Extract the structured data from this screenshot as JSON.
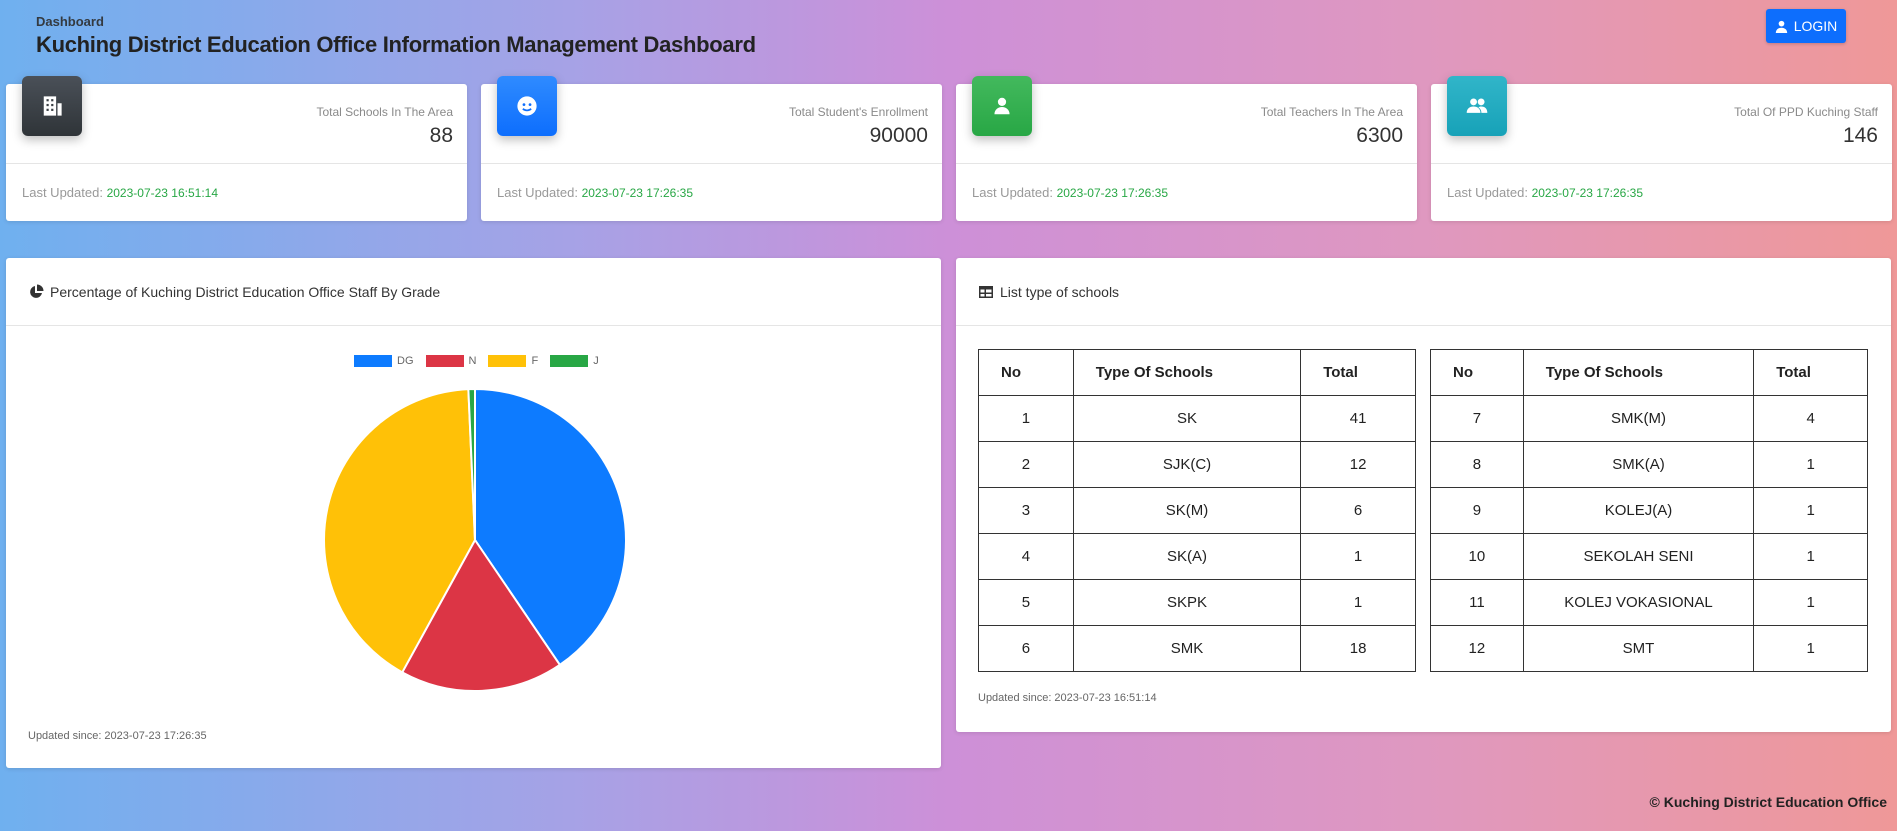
{
  "header": {
    "breadcrumb": "Dashboard",
    "title": "Kuching District Education Office Information Management Dashboard",
    "login_label": "LOGIN"
  },
  "stats": [
    {
      "label": "Total Schools In The Area",
      "value": "88",
      "updated_label": "Last Updated:",
      "updated": "2023-07-23 16:51:14",
      "color": "#343a40",
      "icon": "building-icon"
    },
    {
      "label": "Total Student's Enrollment",
      "value": "90000",
      "updated_label": "Last Updated:",
      "updated": "2023-07-23 17:26:35",
      "color": "#0d6efd",
      "icon": "student-icon"
    },
    {
      "label": "Total Teachers In The Area",
      "value": "6300",
      "updated_label": "Last Updated:",
      "updated": "2023-07-23 17:26:35",
      "color": "#28a745",
      "icon": "teacher-icon"
    },
    {
      "label": "Total Of PPD Kuching Staff",
      "value": "146",
      "updated_label": "Last Updated:",
      "updated": "2023-07-23 17:26:35",
      "color": "#17a2b8",
      "icon": "users-icon"
    }
  ],
  "chart_panel": {
    "title": "Percentage of Kuching District Education Office Staff By Grade",
    "footer": "Updated since: 2023-07-23 17:26:35"
  },
  "chart_data": {
    "type": "pie",
    "title": "",
    "labels": [
      "DG",
      "N",
      "F",
      "J"
    ],
    "values": [
      40.5,
      17.5,
      41.3,
      0.7
    ],
    "colors": [
      "#0d7bff",
      "#dc3545",
      "#ffc107",
      "#28a745"
    ]
  },
  "table_panel": {
    "title": "List type of schools",
    "footer": "Updated since: 2023-07-23 16:51:14",
    "headers": [
      "No",
      "Type Of Schools",
      "Total"
    ],
    "left_rows": [
      [
        "1",
        "SK",
        "41"
      ],
      [
        "2",
        "SJK(C)",
        "12"
      ],
      [
        "3",
        "SK(M)",
        "6"
      ],
      [
        "4",
        "SK(A)",
        "1"
      ],
      [
        "5",
        "SKPK",
        "1"
      ],
      [
        "6",
        "SMK",
        "18"
      ]
    ],
    "right_rows": [
      [
        "7",
        "SMK(M)",
        "4"
      ],
      [
        "8",
        "SMK(A)",
        "1"
      ],
      [
        "9",
        "KOLEJ(A)",
        "1"
      ],
      [
        "10",
        "SEKOLAH SENI",
        "1"
      ],
      [
        "11",
        "KOLEJ VOKASIONAL",
        "1"
      ],
      [
        "12",
        "SMT",
        "1"
      ]
    ]
  },
  "footer": {
    "copyright": "Kuching District Education Office"
  }
}
